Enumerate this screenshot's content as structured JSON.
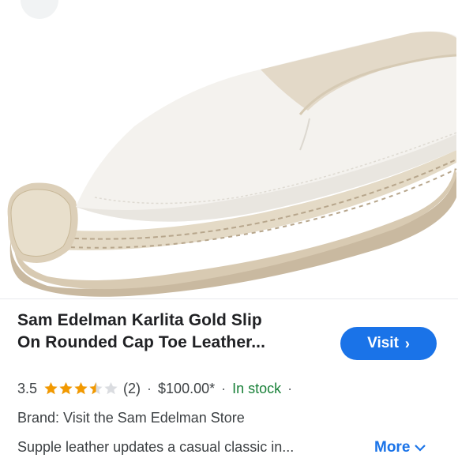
{
  "product": {
    "image_alt": "White leather espadrille slip-on shoe",
    "title_line1": "Sam Edelman Karlita Gold Slip",
    "title_line2": "On Rounded Cap Toe Leather...",
    "visit_label": "Visit",
    "rating_value": "3.5",
    "rating_stars": 3.5,
    "review_count": "(2)",
    "price": "$100.00*",
    "availability": "In stock",
    "brand_line": "Brand: Visit the Sam Edelman Store",
    "description": "Supple leather updates a casual classic in...",
    "more_label": "More"
  },
  "colors": {
    "accent": "#1a73e8",
    "star": "#f29900",
    "in_stock": "#188038",
    "text": "#202124"
  }
}
